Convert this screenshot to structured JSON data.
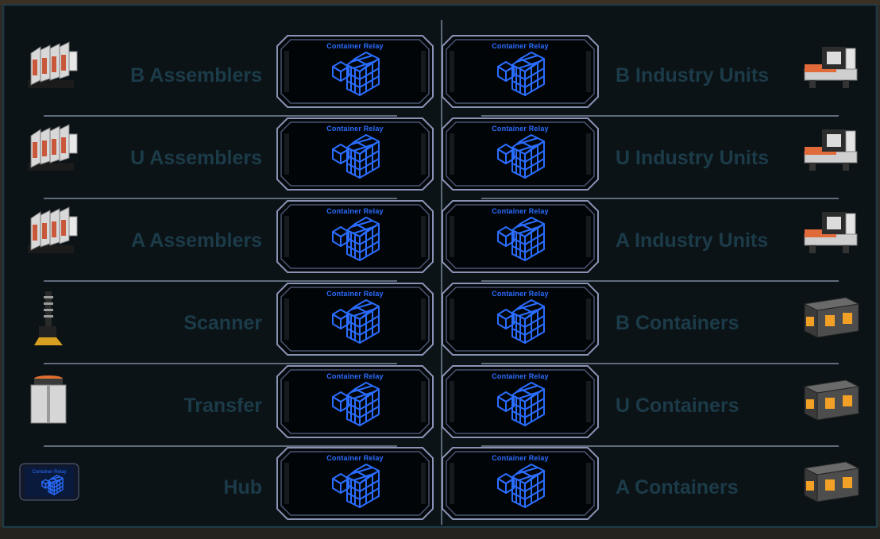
{
  "relay_card_title": "Container Relay",
  "left_rows": [
    {
      "label": "B Assemblers",
      "icon": "assembler-icon"
    },
    {
      "label": "U Assemblers",
      "icon": "assembler-icon"
    },
    {
      "label": "A Assemblers",
      "icon": "assembler-icon"
    },
    {
      "label": "Scanner",
      "icon": "scanner-icon"
    },
    {
      "label": "Transfer",
      "icon": "transfer-unit-icon"
    },
    {
      "label": "Hub",
      "icon": "container-relay-screen-icon"
    }
  ],
  "right_rows": [
    {
      "label": "B Industry Units",
      "icon": "industry-unit-icon"
    },
    {
      "label": "U Industry Units",
      "icon": "industry-unit-icon"
    },
    {
      "label": "A Industry Units",
      "icon": "industry-unit-icon"
    },
    {
      "label": "B Containers",
      "icon": "container-crate-icon"
    },
    {
      "label": "U Containers",
      "icon": "container-crate-icon"
    },
    {
      "label": "A Containers",
      "icon": "container-crate-icon"
    }
  ],
  "hub_thumb_text": "Container Relay",
  "colors": {
    "screen_bg": "#0b1316",
    "label_text": "#1c3b49",
    "relay_accent": "#2a6dff",
    "frame": "#8a93b5"
  }
}
